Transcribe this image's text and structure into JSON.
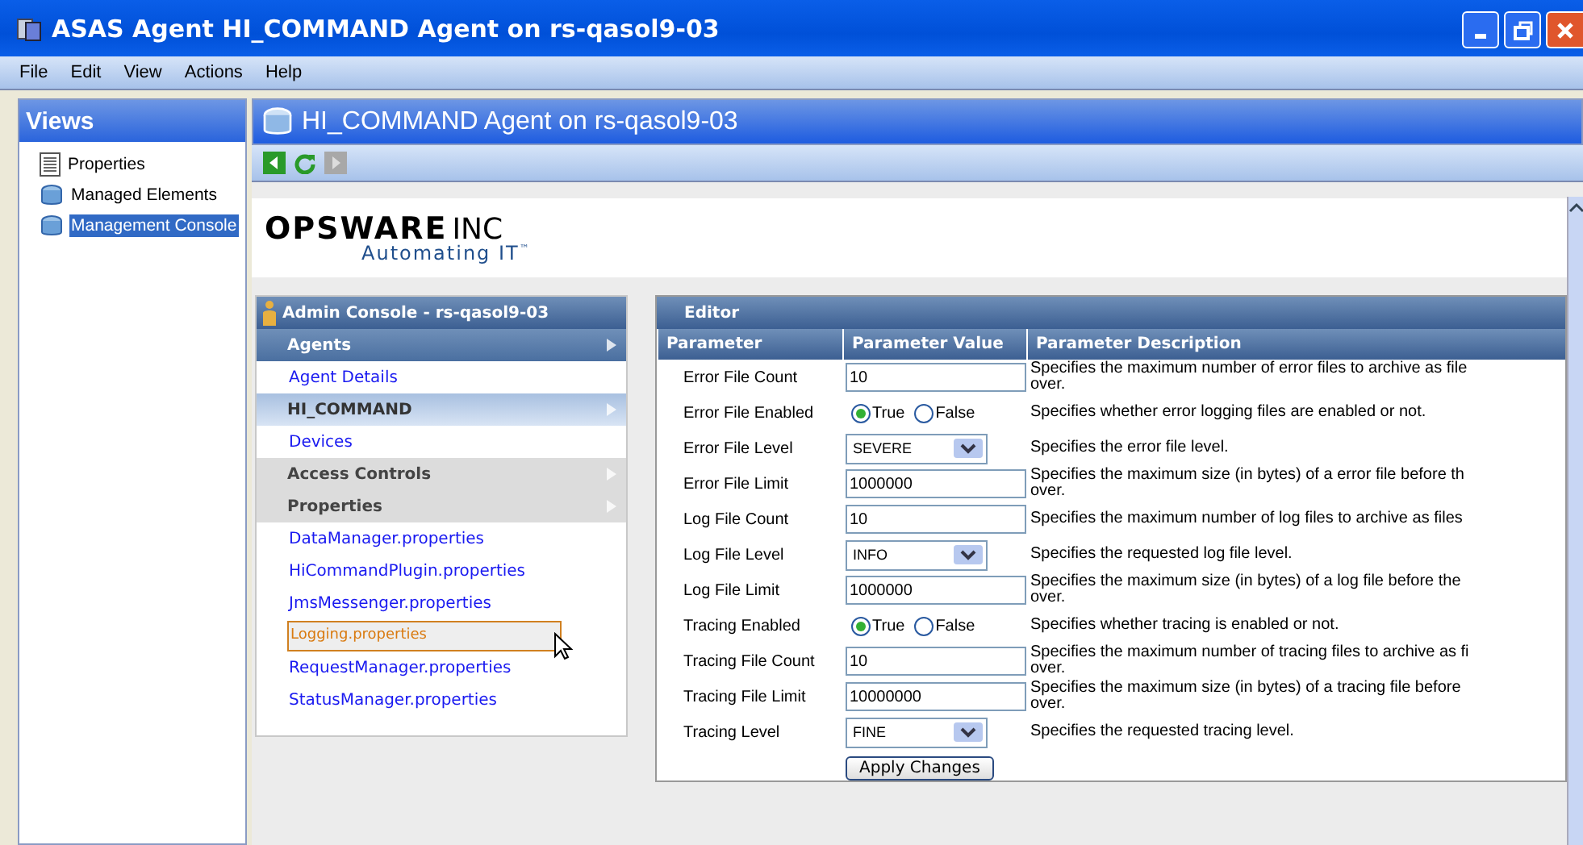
{
  "window": {
    "title": "ASAS Agent HI_COMMAND Agent on rs-qasol9-03"
  },
  "menu": [
    "File",
    "Edit",
    "View",
    "Actions",
    "Help"
  ],
  "views": {
    "title": "Views",
    "items": [
      {
        "label": "Properties",
        "kind": "document",
        "selected": false
      },
      {
        "label": "Managed Elements",
        "kind": "database",
        "selected": false
      },
      {
        "label": "Management Console",
        "kind": "database",
        "selected": true
      }
    ]
  },
  "content": {
    "title": "HI_COMMAND Agent on rs-qasol9-03",
    "toolbar": [
      {
        "kind": "back",
        "disabled": false
      },
      {
        "kind": "refresh",
        "disabled": false
      },
      {
        "kind": "forward",
        "disabled": true
      }
    ],
    "logo": {
      "name": "OPSWARE",
      "suffix": "INC",
      "tagline": "Automating IT",
      "mark": "™"
    }
  },
  "nav": {
    "title": "Admin Console - rs-qasol9-03",
    "items": [
      {
        "kind": "primary-header",
        "label": "Agents"
      },
      {
        "kind": "link",
        "label": "Agent Details",
        "selected": false
      },
      {
        "kind": "secondary-header",
        "label": "HI_COMMAND"
      },
      {
        "kind": "link",
        "label": "Devices",
        "selected": false
      },
      {
        "kind": "group-header",
        "label": "Access Controls"
      },
      {
        "kind": "group-header",
        "label": "Properties"
      },
      {
        "kind": "link",
        "label": "DataManager.properties",
        "selected": false
      },
      {
        "kind": "link",
        "label": "HiCommandPlugin.properties",
        "selected": false
      },
      {
        "kind": "link",
        "label": "JmsMessenger.properties",
        "selected": false
      },
      {
        "kind": "link",
        "label": "Logging.properties",
        "selected": true
      },
      {
        "kind": "link",
        "label": "RequestManager.properties",
        "selected": false
      },
      {
        "kind": "link",
        "label": "StatusManager.properties",
        "selected": false
      }
    ]
  },
  "editor": {
    "title": "Editor",
    "columns": [
      "Parameter",
      "Parameter Value",
      "Parameter Description"
    ],
    "rows": [
      {
        "parameter": "Error File Count",
        "kind": "text",
        "value": "10",
        "description": [
          "Specifies the maximum number of error files to archive as file",
          "over."
        ]
      },
      {
        "parameter": "Error File Enabled",
        "kind": "radio",
        "options": [
          {
            "label": "True",
            "selected": true
          },
          {
            "label": "False",
            "selected": false
          }
        ],
        "description": [
          "Specifies whether error logging files are enabled or not."
        ]
      },
      {
        "parameter": "Error File Level",
        "kind": "select",
        "value": "SEVERE",
        "description": [
          "Specifies the error file level."
        ]
      },
      {
        "parameter": "Error File Limit",
        "kind": "text",
        "value": "1000000",
        "description": [
          "Specifies the maximum size (in bytes) of a error file before th",
          "over."
        ]
      },
      {
        "parameter": "Log File Count",
        "kind": "text",
        "value": "10",
        "description": [
          "Specifies the maximum number of log files to archive as files"
        ]
      },
      {
        "parameter": "Log File Level",
        "kind": "select",
        "value": "INFO",
        "description": [
          "Specifies the requested log file level."
        ]
      },
      {
        "parameter": "Log File Limit",
        "kind": "text",
        "value": "1000000",
        "description": [
          "Specifies the maximum size (in bytes) of a log file before the",
          "over."
        ]
      },
      {
        "parameter": "Tracing Enabled",
        "kind": "radio",
        "options": [
          {
            "label": "True",
            "selected": true
          },
          {
            "label": "False",
            "selected": false
          }
        ],
        "description": [
          "Specifies whether tracing is enabled or not."
        ]
      },
      {
        "parameter": "Tracing File Count",
        "kind": "text",
        "value": "10",
        "description": [
          "Specifies the maximum number of tracing files to archive as fi",
          "over."
        ]
      },
      {
        "parameter": "Tracing File Limit",
        "kind": "text",
        "value": "10000000",
        "description": [
          "Specifies the maximum size (in bytes) of a tracing file before",
          "over."
        ]
      },
      {
        "parameter": "Tracing Level",
        "kind": "select",
        "value": "FINE",
        "description": [
          "Specifies the requested tracing level."
        ]
      }
    ],
    "apply_button": "Apply Changes"
  }
}
